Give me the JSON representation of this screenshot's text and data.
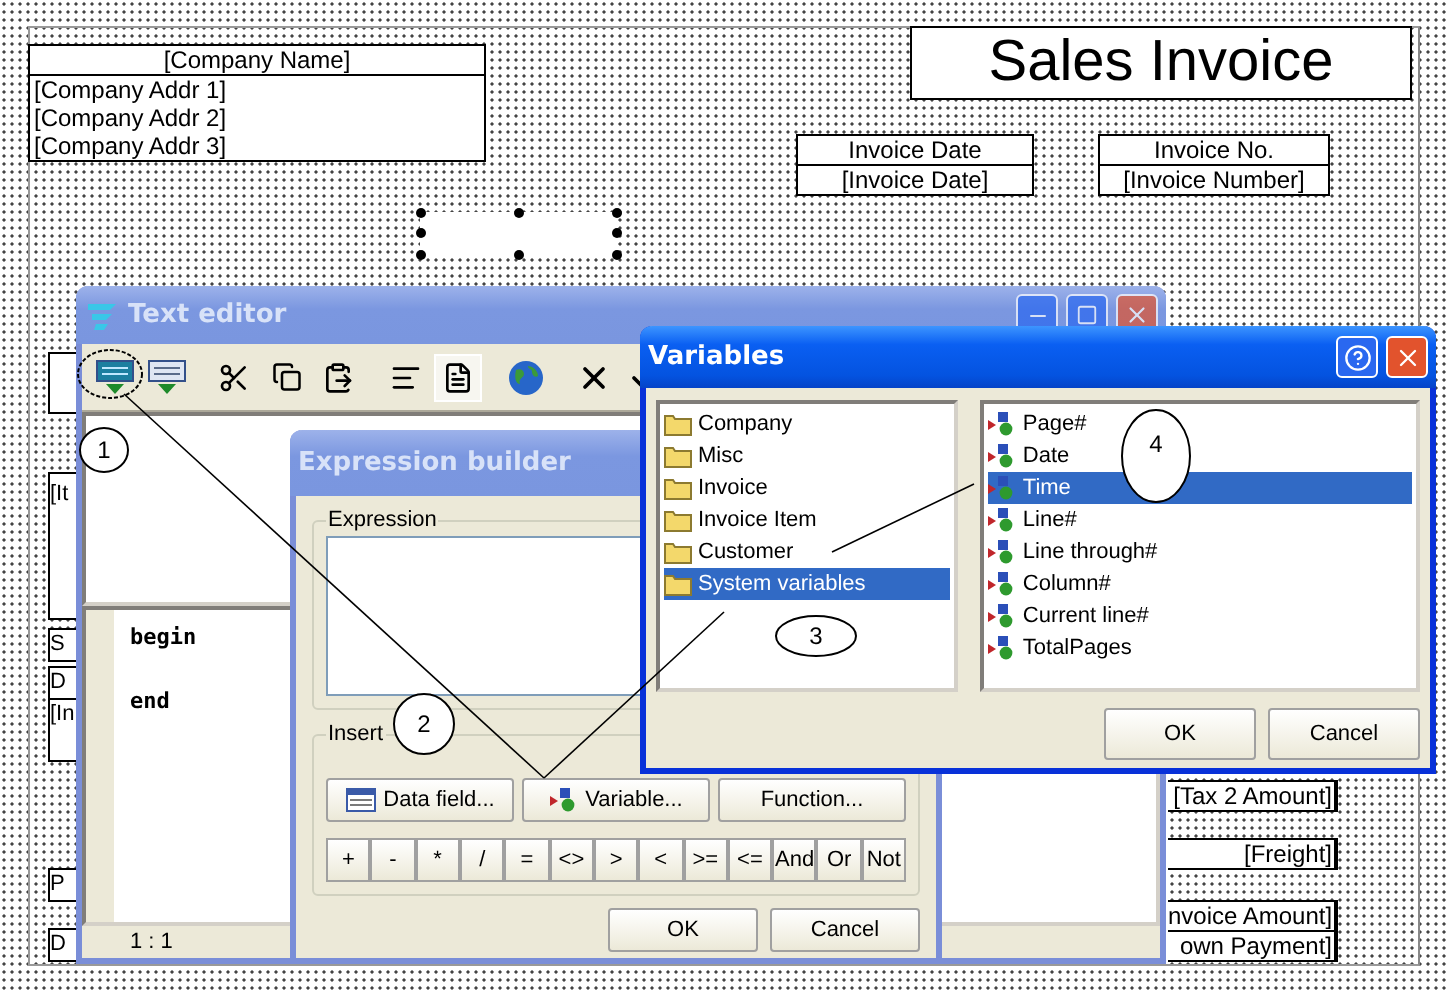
{
  "report": {
    "title": "Sales Invoice",
    "company": {
      "name": "[Company Name]",
      "address_lines": [
        "[Company Addr 1]",
        "[Company Addr 2]",
        "[Company Addr 3]"
      ]
    },
    "header_fields": [
      {
        "label": "Invoice Date",
        "value": "[Invoice Date]"
      },
      {
        "label": "Invoice No.",
        "value": "[Invoice Number]"
      }
    ],
    "left_fields": [
      "[It",
      "S",
      "D",
      "[In",
      "P",
      "D"
    ],
    "right_fields": [
      "[Tax 2 Amount]",
      "[Freight]",
      "nvoice Amount]",
      "own Payment]"
    ]
  },
  "text_editor": {
    "title": "Text editor",
    "code_lines": [
      "begin",
      "end"
    ],
    "cursor_position": "1 : 1"
  },
  "expression_builder": {
    "title": "Expression builder",
    "expression_label": "Expression",
    "insert_label": "Insert",
    "insert_buttons": [
      {
        "label": "Data field...",
        "kind": "data"
      },
      {
        "label": "Variable...",
        "kind": "variable"
      },
      {
        "label": "Function...",
        "kind": "function"
      }
    ],
    "operators": [
      "+",
      "-",
      "*",
      "/",
      "=",
      "<>",
      ">",
      "<",
      ">=",
      "<=",
      "And",
      "Or",
      "Not"
    ],
    "buttons": [
      "OK",
      "Cancel"
    ]
  },
  "variables": {
    "title": "Variables",
    "categories": [
      {
        "label": "Company",
        "selected": false
      },
      {
        "label": "Misc",
        "selected": false
      },
      {
        "label": "Invoice",
        "selected": false
      },
      {
        "label": "Invoice Item",
        "selected": false
      },
      {
        "label": "Customer",
        "selected": false
      },
      {
        "label": "System variables",
        "selected": true
      }
    ],
    "items": [
      {
        "label": "Page#",
        "selected": false
      },
      {
        "label": "Date",
        "selected": false
      },
      {
        "label": "Time",
        "selected": true
      },
      {
        "label": "Line#",
        "selected": false
      },
      {
        "label": "Line through#",
        "selected": false
      },
      {
        "label": "Column#",
        "selected": false
      },
      {
        "label": "Current line#",
        "selected": false
      },
      {
        "label": "TotalPages",
        "selected": false
      }
    ],
    "buttons": [
      "OK",
      "Cancel"
    ]
  },
  "annotations": [
    {
      "label": "1"
    },
    {
      "label": "2"
    },
    {
      "label": "3"
    },
    {
      "label": "4"
    }
  ]
}
